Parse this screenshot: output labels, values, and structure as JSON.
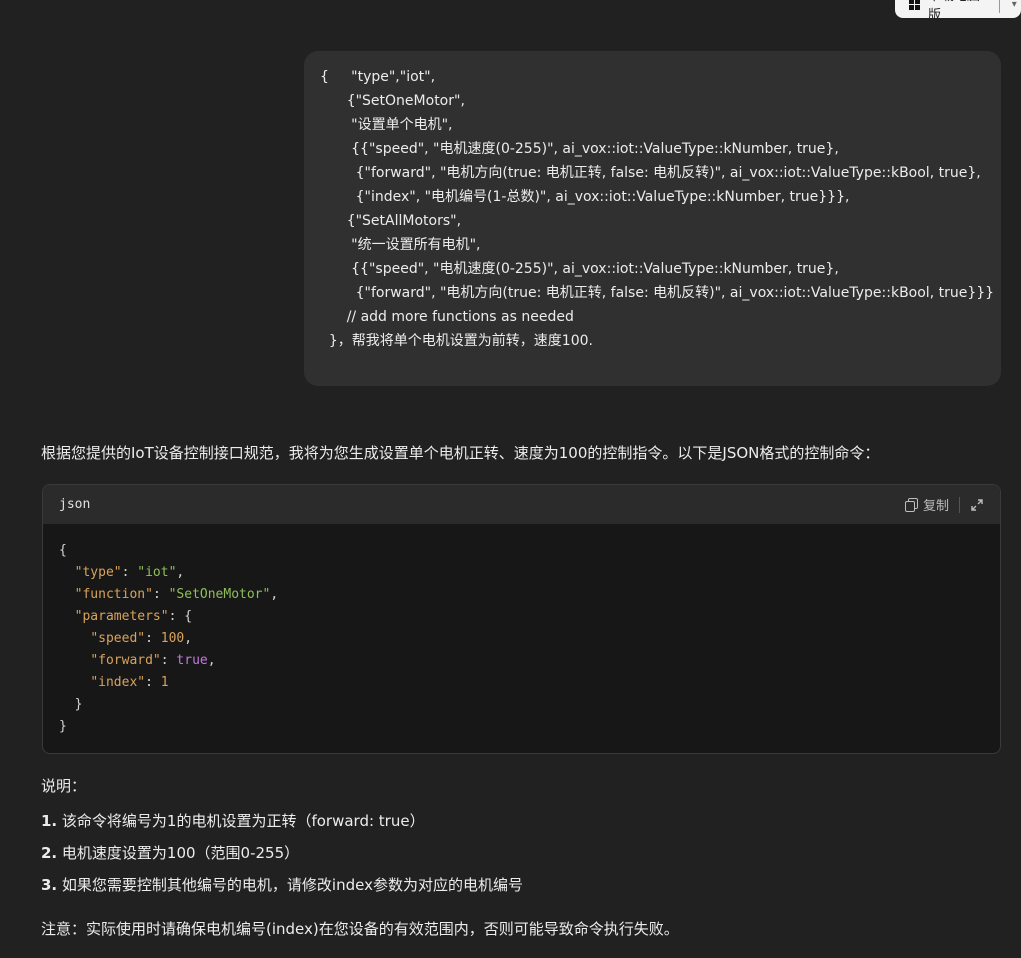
{
  "header": {
    "download_label": "下载电脑版"
  },
  "user_message": {
    "lines": [
      "{     \"type\",\"iot\",",
      "      {\"SetOneMotor\",",
      "       \"设置单个电机\",",
      "       {{\"speed\", \"电机速度(0-255)\", ai_vox::iot::ValueType::kNumber, true},",
      "        {\"forward\", \"电机方向(true: 电机正转, false: 电机反转)\", ai_vox::iot::ValueType::kBool, true},",
      "        {\"index\", \"电机编号(1-总数)\", ai_vox::iot::ValueType::kNumber, true}}},",
      "      {\"SetAllMotors\",",
      "       \"统一设置所有电机\",",
      "       {{\"speed\", \"电机速度(0-255)\", ai_vox::iot::ValueType::kNumber, true},",
      "        {\"forward\", \"电机方向(true: 电机正转, false: 电机反转)\", ai_vox::iot::ValueType::kBool, true}}}",
      "",
      "      // add more functions as needed",
      "  }，帮我将单个电机设置为前转，速度100."
    ]
  },
  "assistant": {
    "intro": "根据您提供的IoT设备控制接口规范，我将为您生成设置单个电机正转、速度为100的控制指令。以下是JSON格式的控制命令：",
    "code_block": {
      "language": "json",
      "copy_label": "复制",
      "lines": [
        [
          {
            "t": "{",
            "c": ""
          }
        ],
        [
          {
            "t": "  ",
            "c": ""
          },
          {
            "t": "\"type\"",
            "c": "k"
          },
          {
            "t": ": ",
            "c": ""
          },
          {
            "t": "\"iot\"",
            "c": "s"
          },
          {
            "t": ",",
            "c": ""
          }
        ],
        [
          {
            "t": "  ",
            "c": ""
          },
          {
            "t": "\"function\"",
            "c": "k"
          },
          {
            "t": ": ",
            "c": ""
          },
          {
            "t": "\"SetOneMotor\"",
            "c": "s"
          },
          {
            "t": ",",
            "c": ""
          }
        ],
        [
          {
            "t": "  ",
            "c": ""
          },
          {
            "t": "\"parameters\"",
            "c": "k"
          },
          {
            "t": ": {",
            "c": ""
          }
        ],
        [
          {
            "t": "    ",
            "c": ""
          },
          {
            "t": "\"speed\"",
            "c": "k"
          },
          {
            "t": ": ",
            "c": ""
          },
          {
            "t": "100",
            "c": "n"
          },
          {
            "t": ",",
            "c": ""
          }
        ],
        [
          {
            "t": "    ",
            "c": ""
          },
          {
            "t": "\"forward\"",
            "c": "k"
          },
          {
            "t": ": ",
            "c": ""
          },
          {
            "t": "true",
            "c": "b"
          },
          {
            "t": ",",
            "c": ""
          }
        ],
        [
          {
            "t": "    ",
            "c": ""
          },
          {
            "t": "\"index\"",
            "c": "k"
          },
          {
            "t": ": ",
            "c": ""
          },
          {
            "t": "1",
            "c": "n"
          }
        ],
        [
          {
            "t": "  }",
            "c": ""
          }
        ],
        [
          {
            "t": "}",
            "c": ""
          }
        ]
      ]
    },
    "notes_title": "说明：",
    "notes": [
      {
        "num": "1.",
        "text": "该命令将编号为1的电机设置为正转（forward: true）"
      },
      {
        "num": "2.",
        "text": "电机速度设置为100（范围0-255）"
      },
      {
        "num": "3.",
        "text": "如果您需要控制其他编号的电机，请修改index参数为对应的电机编号"
      }
    ],
    "warning": "注意：实际使用时请确保电机编号(index)在您设备的有效范围内，否则可能导致命令执行失败。"
  }
}
